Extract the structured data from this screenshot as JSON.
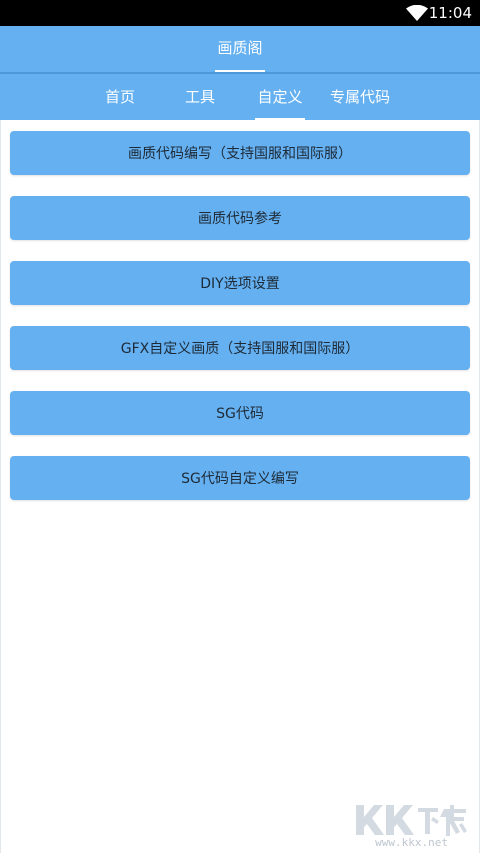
{
  "status_bar": {
    "time": "11:04",
    "wifi_icon": "wifi-icon"
  },
  "app_bar": {
    "title": "画质阁"
  },
  "tabs": [
    {
      "label": "首页"
    },
    {
      "label": "工具"
    },
    {
      "label": "自定义",
      "selected": true
    },
    {
      "label": "专属代码"
    }
  ],
  "menu_items": [
    {
      "label": "画质代码编写（支持国服和国际服）"
    },
    {
      "label": "画质代码参考"
    },
    {
      "label": "DIY选项设置"
    },
    {
      "label": "GFX自定义画质（支持国服和国际服）"
    },
    {
      "label": "SG代码"
    },
    {
      "label": "SG代码自定义编写"
    }
  ],
  "watermark": {
    "logo_text": "KK下载",
    "url": "www.kkx.net"
  },
  "colors": {
    "accent": "#64b0f1",
    "status_bar": "#000000",
    "background": "#ffffff",
    "button_text": "#1e2a36"
  }
}
